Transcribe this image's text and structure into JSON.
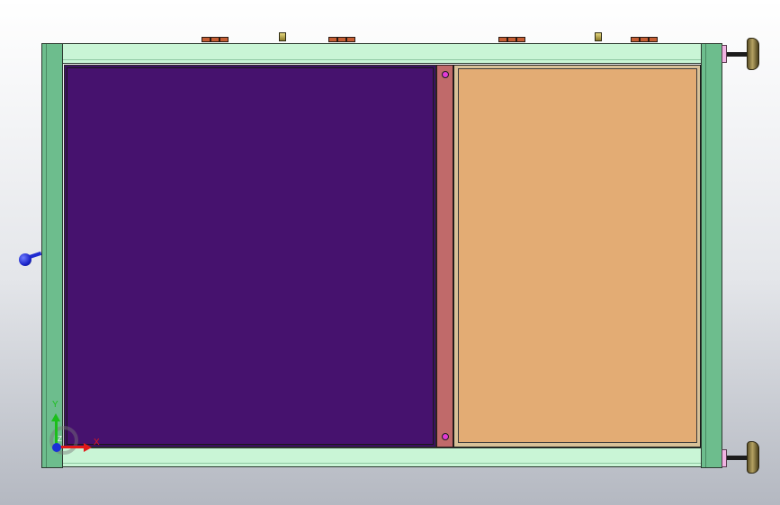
{
  "view": {
    "background_gradient": [
      "#ffffff",
      "#e4e6ea",
      "#b4b8c1"
    ]
  },
  "colors": {
    "frame_side": "#6dbd8d",
    "frame_rail": "#c9f5d6",
    "panel_left": "#46126e",
    "panel_right": "#e3ac74",
    "divider": "#c06a6a",
    "divider_hole": "#e23ad6",
    "foot_pad": "#f0b4e2",
    "knob": "#1a24c9"
  },
  "triad": {
    "x_label": "X",
    "y_label": "Y",
    "z_label": "Z"
  },
  "icons": {
    "knob": "handle-knob-icon",
    "foot": "leveling-foot-icon",
    "triad": "axis-triad-icon"
  }
}
